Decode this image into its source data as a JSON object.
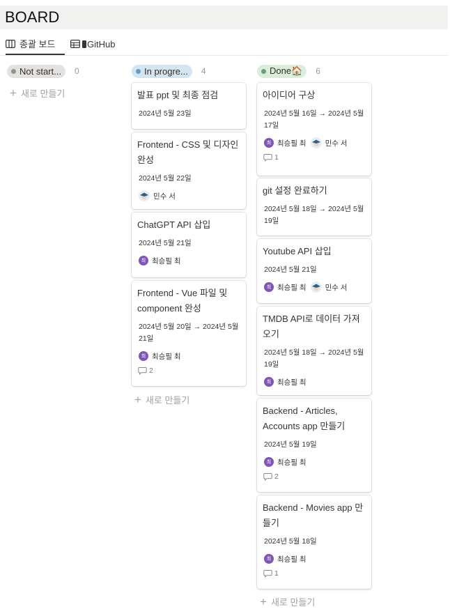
{
  "page": {
    "title": "BOARD"
  },
  "tabs": [
    {
      "label": "종괄 보드",
      "icon": "board-icon",
      "active": true
    },
    {
      "label": "GitHub",
      "icon": "table-icon",
      "active": false
    }
  ],
  "colors": {
    "not_started": "#e3e2e0",
    "in_progress": "#d3e5ef",
    "done": "#dbeddb"
  },
  "columns": [
    {
      "name": "Not start...",
      "count": "0",
      "dot": "#91918e",
      "new_label": "새로 만들기",
      "cards": []
    },
    {
      "name": "In progre...",
      "count": "4",
      "dot": "#5e9fcb",
      "new_label": "새로 만들기",
      "cards": [
        {
          "title": "발표 ppt 및 최종 점검",
          "date": "2024년 5월 23일"
        },
        {
          "title": "Frontend - CSS 및 디자인 완성",
          "date": "2024년 5월 22일",
          "person2": "민수 서"
        },
        {
          "title": "ChatGPT API 삽입",
          "date": "2024년 5월 21일",
          "person1": "최승필 최"
        },
        {
          "title": "Frontend - Vue 파일 및 component 완성",
          "date": "2024년 5월 20일 → 2024년 5월 21일",
          "person1": "최승필 최",
          "comments": "2"
        }
      ]
    },
    {
      "name": "Done🏠",
      "count": "6",
      "dot": "#6c9b7d",
      "new_label": "새로 만들기",
      "cards": [
        {
          "title": "아이디어 구상",
          "date": "2024년 5월 16일 → 2024년 5월 17일",
          "person1": "최승필 최",
          "person2": "민수 서",
          "comments": "1"
        },
        {
          "title": "git 설정 완료하기",
          "date": "2024년 5월 18일 → 2024년 5월 19일"
        },
        {
          "title": "Youtube API 삽입",
          "date": "2024년 5월 21일",
          "person1": "최승필 최",
          "person2": "민수 서"
        },
        {
          "title": "TMDB API로 데이터 가져오기",
          "date": "2024년 5월 18일 → 2024년 5월 19일",
          "person1": "최승필 최"
        },
        {
          "title": "Backend - Articles, Accounts app 만들기",
          "date": "2024년 5월 19일",
          "person1": "최승필 최",
          "comments": "2"
        },
        {
          "title": "Backend - Movies app 만들기",
          "date": "2024년 5월 18일",
          "person1": "최승필 최",
          "comments": "1"
        }
      ]
    }
  ]
}
